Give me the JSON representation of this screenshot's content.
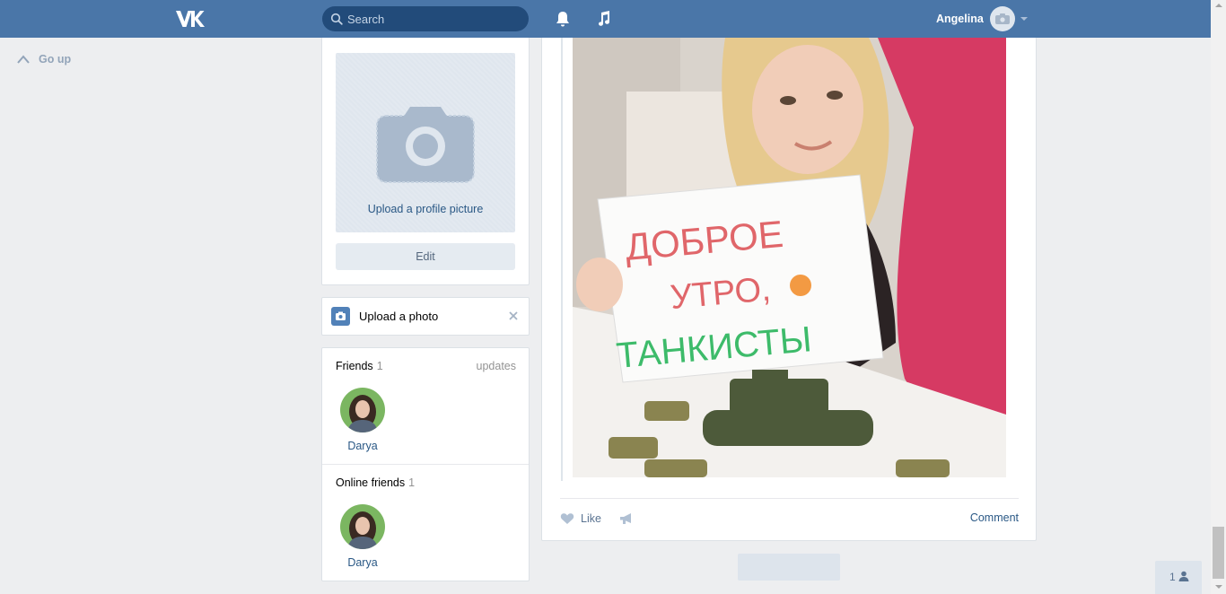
{
  "header": {
    "search_placeholder": "Search",
    "username": "Angelina"
  },
  "nav": {
    "go_up": "Go up"
  },
  "profile": {
    "upload_picture": "Upload a profile picture",
    "edit": "Edit"
  },
  "upload_photo": {
    "label": "Upload a photo"
  },
  "friends": {
    "title": "Friends",
    "count": "1",
    "updates": "updates",
    "items": [
      {
        "name": "Darya"
      }
    ]
  },
  "online_friends": {
    "title": "Online friends",
    "count": "1",
    "items": [
      {
        "name": "Darya"
      }
    ]
  },
  "post": {
    "sign_line1": "ДОБРОЕ",
    "sign_line2": "УТРО,",
    "sign_line3": "ТАНКИСТЫ",
    "like": "Like",
    "comment": "Comment"
  },
  "chat": {
    "online_count": "1"
  },
  "colors": {
    "header": "#4a76a8",
    "link": "#2a5885",
    "background": "#edeef0"
  },
  "icons": [
    "vk-logo-icon",
    "search-icon",
    "bell-icon",
    "music-icon",
    "camera-icon",
    "chevron-up-icon",
    "close-icon",
    "heart-icon",
    "megaphone-icon",
    "user-icon"
  ]
}
